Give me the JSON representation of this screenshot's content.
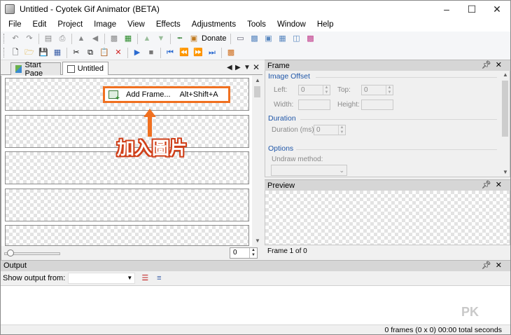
{
  "window": {
    "title": "Untitled - Cyotek Gif Animator (BETA)"
  },
  "menu": [
    "File",
    "Edit",
    "Project",
    "Image",
    "View",
    "Effects",
    "Adjustments",
    "Tools",
    "Window",
    "Help"
  ],
  "toolbar": {
    "donate_label": "Donate"
  },
  "tabs": {
    "start_page": "Start Page",
    "untitled": "Untitled"
  },
  "frames_pane": {
    "frame_number": "0"
  },
  "context_menu": {
    "add_frame_label": "Add Frame...",
    "add_frame_shortcut": "Alt+Shift+A"
  },
  "annotation": {
    "text": "加入圖片",
    "color": "#f07020"
  },
  "frame_panel": {
    "title": "Frame",
    "image_offset": {
      "heading": "Image Offset",
      "left_label": "Left:",
      "left_value": "0",
      "top_label": "Top:",
      "top_value": "0",
      "width_label": "Width:",
      "height_label": "Height:"
    },
    "duration": {
      "heading": "Duration",
      "duration_label": "Duration (ms):",
      "duration_value": "0"
    },
    "options": {
      "heading": "Options",
      "undraw_label": "Undraw method:"
    }
  },
  "preview_panel": {
    "title": "Preview",
    "status": "Frame 1 of 0"
  },
  "output_panel": {
    "title": "Output",
    "show_output_label": "Show output from:"
  },
  "status_bar": {
    "text": "0 frames (0 x 0)   00:00 total seconds"
  },
  "watermark": "PK"
}
